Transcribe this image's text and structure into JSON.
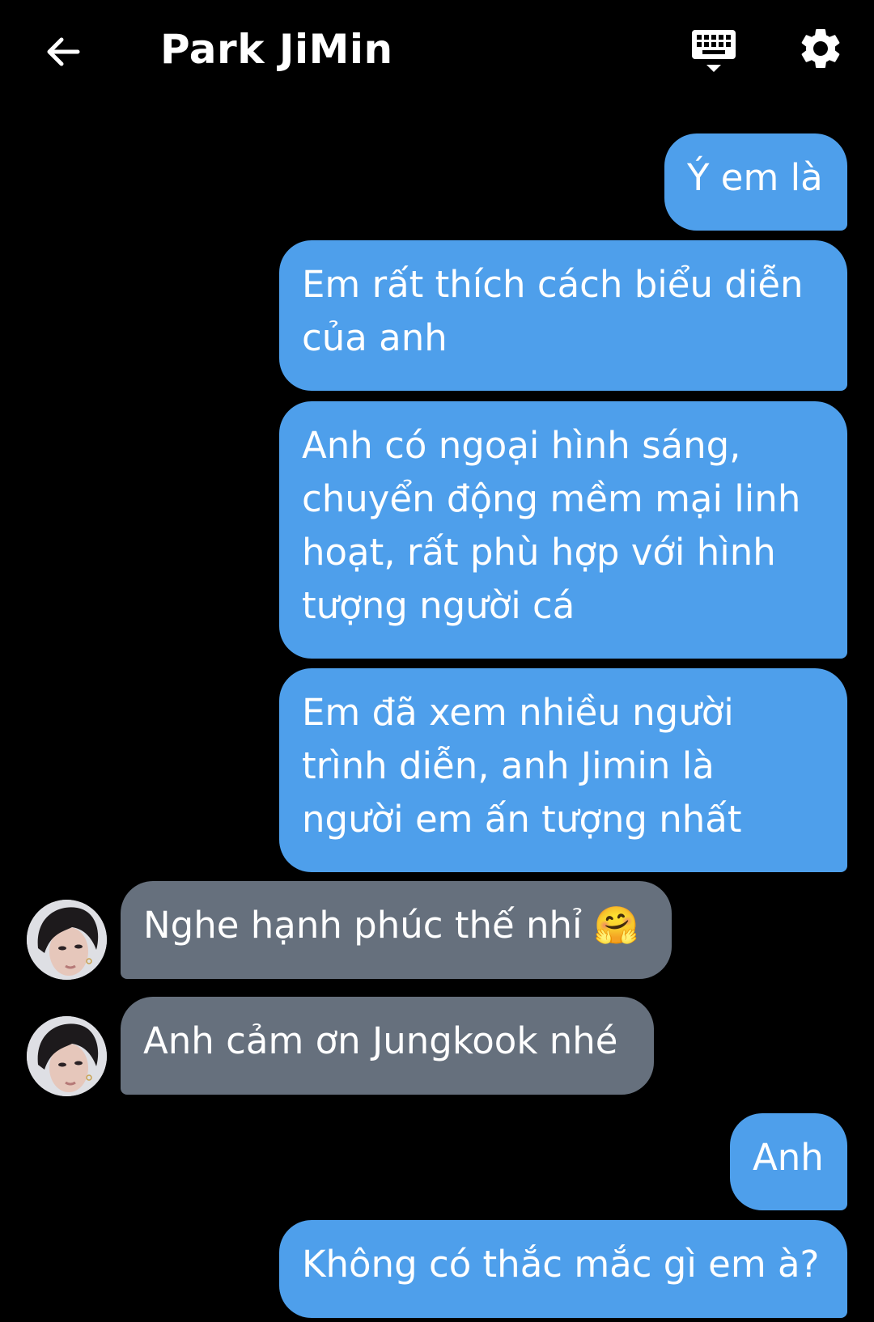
{
  "header": {
    "title": "Park JiMin",
    "back_icon": "arrow-left-icon",
    "keyboard_icon": "keyboard-icon",
    "settings_icon": "gear-icon"
  },
  "colors": {
    "background": "#000000",
    "outgoing_bubble": "#4e9feb",
    "incoming_bubble": "#66707d",
    "text": "#ffffff"
  },
  "messages": [
    {
      "side": "out",
      "text": "Ý em là"
    },
    {
      "side": "out",
      "text": "Em rất thích cách biểu diễn của anh"
    },
    {
      "side": "out",
      "text": "Anh có ngoại hình sáng, chuyển động mềm mại linh hoạt, rất phù hợp với hình tượng người cá"
    },
    {
      "side": "out",
      "text": "Em đã xem nhiều người trình diễn, anh Jimin là người em ấn tượng nhất"
    },
    {
      "side": "in",
      "text": "Nghe hạnh phúc thế nhỉ 🤗"
    },
    {
      "side": "in",
      "text": "Anh cảm ơn Jungkook nhé"
    },
    {
      "side": "out",
      "text": "Anh"
    },
    {
      "side": "out",
      "text": "Không có thắc mắc gì em à?"
    }
  ]
}
